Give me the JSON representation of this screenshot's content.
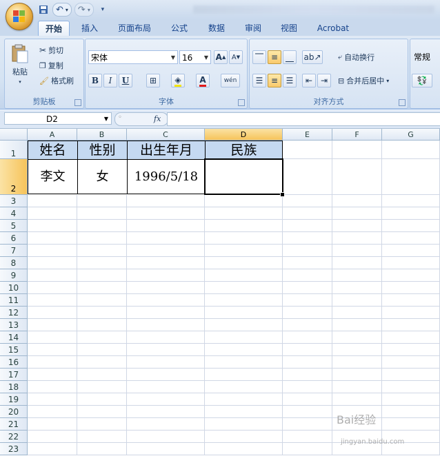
{
  "app": {
    "quick_access": {
      "save_icon": "save-icon",
      "undo_icon": "undo-icon",
      "redo_icon": "redo-icon",
      "customize": "▾"
    }
  },
  "tabs": [
    {
      "label": "开始",
      "active": true
    },
    {
      "label": "插入"
    },
    {
      "label": "页面布局"
    },
    {
      "label": "公式"
    },
    {
      "label": "数据"
    },
    {
      "label": "审阅"
    },
    {
      "label": "视图"
    },
    {
      "label": "Acrobat"
    }
  ],
  "ribbon": {
    "clipboard": {
      "label": "剪贴板",
      "paste": "粘贴",
      "cut": "剪切",
      "copy": "复制",
      "format_painter": "格式刷"
    },
    "font": {
      "label": "字体",
      "font_name": "宋体",
      "font_size": "16",
      "bold": "B",
      "italic": "I",
      "underline": "U",
      "grow": "A",
      "shrink": "A",
      "wen": "wén"
    },
    "alignment": {
      "label": "对齐方式",
      "wrap_text": "自动换行",
      "merge_center": "合并后居中"
    },
    "number": {
      "format": "常规"
    }
  },
  "formula_bar": {
    "name_box": "D2",
    "fx": "fx",
    "value": ""
  },
  "sheet": {
    "active_cell": "D2",
    "selected_column": "D",
    "selected_row": "2",
    "columns": [
      "A",
      "B",
      "C",
      "D",
      "E",
      "F",
      "G"
    ],
    "rows": [
      "1",
      "2",
      "3",
      "4",
      "5",
      "6",
      "7",
      "8",
      "9",
      "10",
      "11",
      "12",
      "13",
      "14",
      "15",
      "16",
      "17",
      "18",
      "19",
      "20",
      "21",
      "22",
      "23"
    ],
    "header_row": [
      "姓名",
      "性别",
      "出生年月",
      "民族"
    ],
    "data_row": [
      "李文",
      "女",
      "1996/5/18",
      ""
    ],
    "colors": {
      "header_fill": "#c5d9f1",
      "selection": "#f6c35a"
    }
  },
  "watermark": {
    "text": "Bai经验",
    "subtext": "jingyan.baidu.com"
  }
}
